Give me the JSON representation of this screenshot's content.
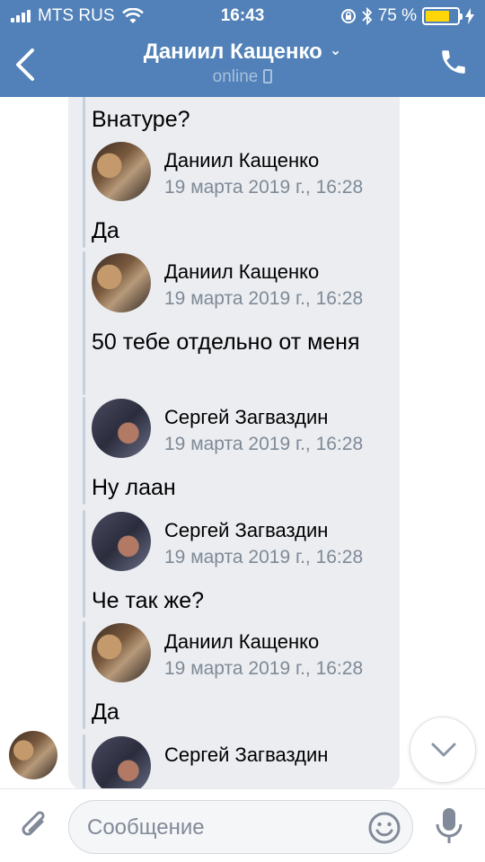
{
  "status_bar": {
    "carrier": "MTS RUS",
    "time": "16:43",
    "battery_percent": "75 %",
    "battery_level": 0.75,
    "battery_color": "#ffd60a"
  },
  "nav": {
    "title": "Даниил Кащенко",
    "subtitle": "online",
    "bar_color": "#5181b8"
  },
  "messages": [
    {
      "name": "",
      "date": "19 марта 2019 г., 16:28",
      "text": "Внатуре?",
      "avatar": "daniil"
    },
    {
      "name": "Даниил Кащенко",
      "date": "19 марта 2019 г., 16:28",
      "text": "Да",
      "avatar": "daniil"
    },
    {
      "name": "Даниил Кащенко",
      "date": "19 марта 2019 г., 16:28",
      "text": "50 тебе отдельно от меня",
      "avatar": "daniil"
    },
    {
      "name": "Сергей Загваздин",
      "date": "19 марта 2019 г., 16:28",
      "text": "Ну лаан",
      "avatar": "sergey"
    },
    {
      "name": "Сергей Загваздин",
      "date": "19 марта 2019 г., 16:28",
      "text": "Че так же?",
      "avatar": "sergey"
    },
    {
      "name": "Даниил Кащенко",
      "date": "19 марта 2019 г., 16:28",
      "text": "Да",
      "avatar": "daniil"
    },
    {
      "name": "Сергей Загваздин",
      "date": "",
      "text": "",
      "avatar": "sergey"
    }
  ],
  "input": {
    "placeholder": "Сообщение"
  },
  "icons": {
    "back": "chevron-left-icon",
    "call": "phone-icon",
    "attach": "paperclip-icon",
    "emoji": "smile-icon",
    "voice": "microphone-icon",
    "scroll": "chevron-down-icon"
  }
}
